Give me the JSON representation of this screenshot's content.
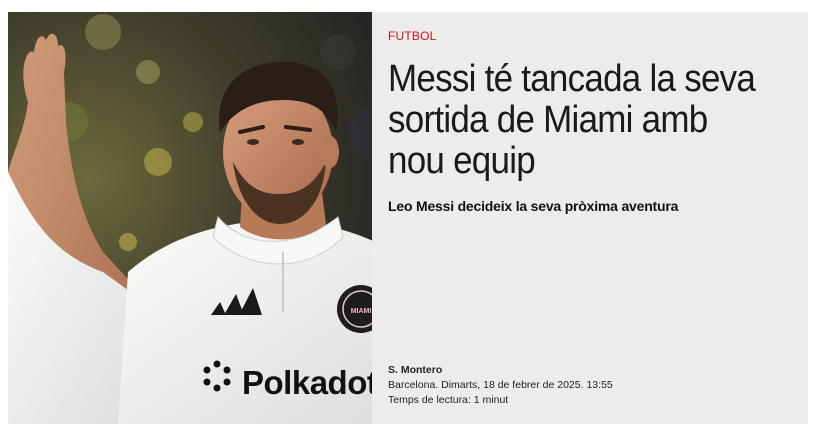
{
  "article": {
    "category": "FUTBOL",
    "headline": "Messi té tancada la seva sortida de Miami amb nou equip",
    "subtitle": "Leo Messi decideix la seva pròxima aventura",
    "author": "S. Montero",
    "dateline": "Barcelona. Dimarts, 18 de febrer de 2025. 13:55",
    "reading_time": "Temps de lectura: 1 minut"
  },
  "image": {
    "sponsor_text": "Polkadot",
    "crest_text": "MIAMI"
  },
  "colors": {
    "category": "#d0121b",
    "panel_bg": "#ececec",
    "jersey": "#f3f3f1"
  }
}
